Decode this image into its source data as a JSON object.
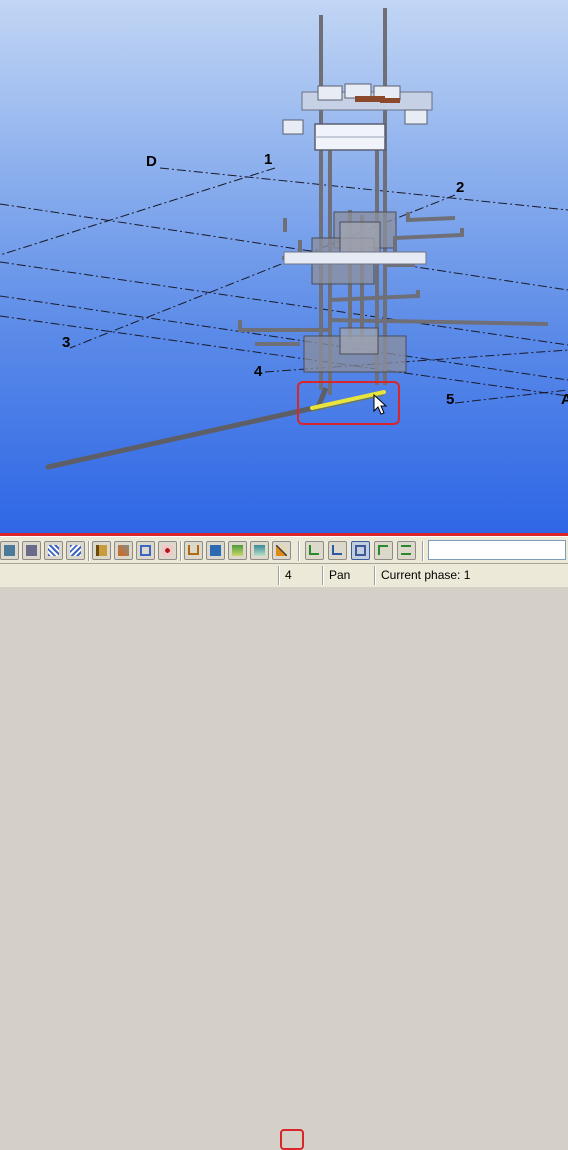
{
  "viewport": {
    "grid_labels": [
      "D",
      "1",
      "2",
      "3",
      "4",
      "5",
      "A"
    ]
  },
  "toolbar": {
    "buttons": [
      {
        "icon": "display-mode-icon"
      },
      {
        "icon": "hidden-line-icon"
      },
      {
        "icon": "grid-display-icon"
      },
      {
        "icon": "snap-icon"
      },
      {
        "icon": "pipe-object-icon"
      },
      {
        "icon": "tools-icon"
      },
      {
        "icon": "window-frame-icon"
      },
      {
        "icon": "pattern-icon"
      },
      {
        "icon": "fitting-icon"
      },
      {
        "icon": "equipment-icon"
      },
      {
        "icon": "layers-icon"
      },
      {
        "icon": "diagonal-tool-icon"
      },
      {
        "icon": "view-front-icon"
      },
      {
        "icon": "view-side-icon"
      },
      {
        "icon": "view-fit-icon"
      },
      {
        "icon": "view-top-icon"
      },
      {
        "icon": "view-iso-icon"
      }
    ],
    "input_value": ""
  },
  "statusbar": {
    "zoom_value": "4",
    "mode": "Pan",
    "phase": "Current phase: 1"
  },
  "colors": {
    "highlight_red": "#d8262a",
    "selected_pipe": "#e8e43c",
    "pipe_gray": "#6f6f78"
  }
}
